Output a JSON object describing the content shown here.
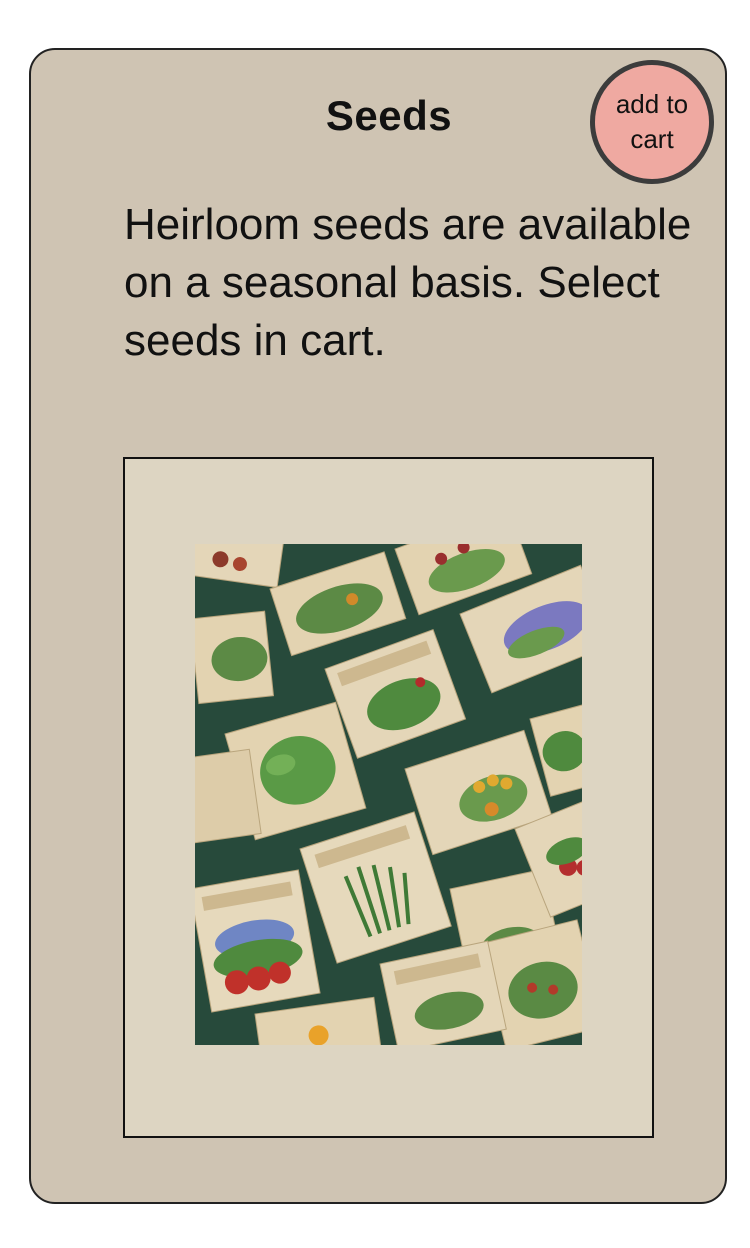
{
  "card": {
    "title": "Seeds",
    "add_to_cart_label": "add to cart",
    "description": "Heirloom seeds are available on a seasonal basis. Select seeds in cart."
  },
  "image": {
    "subject": "seed-packets-illustration"
  },
  "colors": {
    "card_background": "#cfc4b3",
    "frame_background": "#ddd5c2",
    "button_background": "#efa9a1",
    "photo_background": "#274a3b"
  }
}
